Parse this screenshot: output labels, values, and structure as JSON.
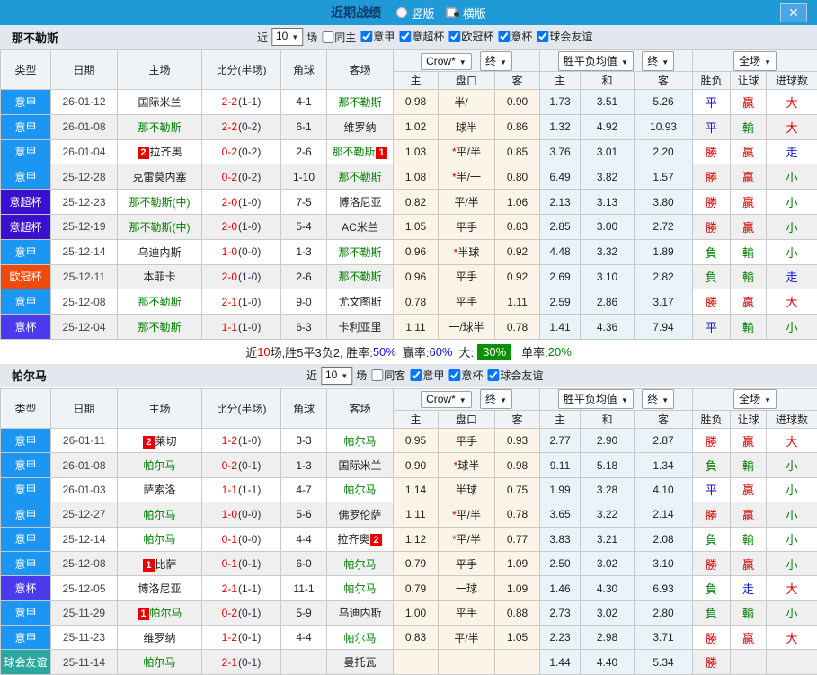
{
  "titlebar": {
    "title": "近期战绩",
    "vertical_label": "竖版",
    "horizontal_label": "横版",
    "selected_layout": "横版",
    "close_icon": "✕"
  },
  "colors": {
    "titlebar_blue": "#1f9ad6",
    "score_red": "#e60000",
    "subject_team_green": "#008000",
    "win_red": "#d40000",
    "lose_green": "#008000",
    "draw_blue": "#1414cc",
    "big_rate_chip_green": "#089000"
  },
  "columns": {
    "type": "类型",
    "date": "日期",
    "home": "主场",
    "score": "比分(半场)",
    "corner": "角球",
    "away": "客场",
    "crow_select": "Crow*",
    "final_select": "终",
    "mean_select": "胜平负均值",
    "final_select2": "终",
    "scope_select": "全场",
    "sub": [
      "主",
      "盘口",
      "客",
      "主",
      "和",
      "客",
      "胜负",
      "让球",
      "进球数"
    ]
  },
  "type_colors": {
    "意甲": "#1b97f3",
    "意超杯": "#3a0fd0",
    "欧冠杯": "#f04a0a",
    "意杯": "#4b3bef",
    "球会友谊": "#2aa8a0"
  },
  "sections": [
    {
      "team": "那不勒斯",
      "filters": {
        "recent_label": "近",
        "count": "10",
        "games_label": "场",
        "same_label": "同主",
        "same_checked": false,
        "leagues": [
          {
            "label": "意甲",
            "checked": true
          },
          {
            "label": "意超杯",
            "checked": true
          },
          {
            "label": "欧冠杯",
            "checked": true
          },
          {
            "label": "意杯",
            "checked": true
          },
          {
            "label": "球会友谊",
            "checked": true
          }
        ]
      },
      "rows": [
        {
          "type": "意甲",
          "date": "26-01-12",
          "home": "国际米兰",
          "home_green": false,
          "home_badge": "",
          "score": "2-2",
          "half": "(1-1)",
          "corner": "4-1",
          "away": "那不勒斯",
          "away_green": true,
          "away_badge": "",
          "crow_home": "0.98",
          "handicap": "半/一",
          "star": false,
          "crow_away": "0.90",
          "mean_home": "1.73",
          "mean_draw": "3.51",
          "mean_away": "5.26",
          "result": "平",
          "result_c": "b",
          "let": "贏",
          "let_c": "r",
          "goal": "大",
          "goal_c": "r"
        },
        {
          "type": "意甲",
          "date": "26-01-08",
          "home": "那不勒斯",
          "home_green": true,
          "home_badge": "",
          "score": "2-2",
          "half": "(0-2)",
          "corner": "6-1",
          "away": "维罗纳",
          "away_green": false,
          "away_badge": "",
          "crow_home": "1.02",
          "handicap": "球半",
          "star": false,
          "crow_away": "0.86",
          "mean_home": "1.32",
          "mean_draw": "4.92",
          "mean_away": "10.93",
          "result": "平",
          "result_c": "b",
          "let": "輸",
          "let_c": "g",
          "goal": "大",
          "goal_c": "r"
        },
        {
          "type": "意甲",
          "date": "26-01-04",
          "home": "拉齐奥",
          "home_green": false,
          "home_badge": "2",
          "score": "0-2",
          "half": "(0-2)",
          "corner": "2-6",
          "away": "那不勒斯",
          "away_green": true,
          "away_badge": "1",
          "crow_home": "1.03",
          "handicap": "平/半",
          "star": true,
          "crow_away": "0.85",
          "mean_home": "3.76",
          "mean_draw": "3.01",
          "mean_away": "2.20",
          "result": "勝",
          "result_c": "r",
          "let": "贏",
          "let_c": "r",
          "goal": "走",
          "goal_c": "b"
        },
        {
          "type": "意甲",
          "date": "25-12-28",
          "home": "克雷莫内塞",
          "home_green": false,
          "home_badge": "",
          "score": "0-2",
          "half": "(0-2)",
          "corner": "1-10",
          "away": "那不勒斯",
          "away_green": true,
          "away_badge": "",
          "crow_home": "1.08",
          "handicap": "半/一",
          "star": true,
          "crow_away": "0.80",
          "mean_home": "6.49",
          "mean_draw": "3.82",
          "mean_away": "1.57",
          "result": "勝",
          "result_c": "r",
          "let": "贏",
          "let_c": "r",
          "goal": "小",
          "goal_c": "g"
        },
        {
          "type": "意超杯",
          "date": "25-12-23",
          "home": "那不勒斯(中)",
          "home_green": true,
          "home_badge": "",
          "score": "2-0",
          "half": "(1-0)",
          "corner": "7-5",
          "away": "博洛尼亚",
          "away_green": false,
          "away_badge": "",
          "crow_home": "0.82",
          "handicap": "平/半",
          "star": false,
          "crow_away": "1.06",
          "mean_home": "2.13",
          "mean_draw": "3.13",
          "mean_away": "3.80",
          "result": "勝",
          "result_c": "r",
          "let": "贏",
          "let_c": "r",
          "goal": "小",
          "goal_c": "g"
        },
        {
          "type": "意超杯",
          "date": "25-12-19",
          "home": "那不勒斯(中)",
          "home_green": true,
          "home_badge": "",
          "score": "2-0",
          "half": "(1-0)",
          "corner": "5-4",
          "away": "AC米兰",
          "away_green": false,
          "away_badge": "",
          "crow_home": "1.05",
          "handicap": "平手",
          "star": false,
          "crow_away": "0.83",
          "mean_home": "2.85",
          "mean_draw": "3.00",
          "mean_away": "2.72",
          "result": "勝",
          "result_c": "r",
          "let": "贏",
          "let_c": "r",
          "goal": "小",
          "goal_c": "g"
        },
        {
          "type": "意甲",
          "date": "25-12-14",
          "home": "乌迪内斯",
          "home_green": false,
          "home_badge": "",
          "score": "1-0",
          "half": "(0-0)",
          "corner": "1-3",
          "away": "那不勒斯",
          "away_green": true,
          "away_badge": "",
          "crow_home": "0.96",
          "handicap": "半球",
          "star": true,
          "crow_away": "0.92",
          "mean_home": "4.48",
          "mean_draw": "3.32",
          "mean_away": "1.89",
          "result": "負",
          "result_c": "g",
          "let": "輸",
          "let_c": "g",
          "goal": "小",
          "goal_c": "g"
        },
        {
          "type": "欧冠杯",
          "date": "25-12-11",
          "home": "本菲卡",
          "home_green": false,
          "home_badge": "",
          "score": "2-0",
          "half": "(1-0)",
          "corner": "2-6",
          "away": "那不勒斯",
          "away_green": true,
          "away_badge": "",
          "crow_home": "0.96",
          "handicap": "平手",
          "star": false,
          "crow_away": "0.92",
          "mean_home": "2.69",
          "mean_draw": "3.10",
          "mean_away": "2.82",
          "result": "負",
          "result_c": "g",
          "let": "輸",
          "let_c": "g",
          "goal": "走",
          "goal_c": "b"
        },
        {
          "type": "意甲",
          "date": "25-12-08",
          "home": "那不勒斯",
          "home_green": true,
          "home_badge": "",
          "score": "2-1",
          "half": "(1-0)",
          "corner": "9-0",
          "away": "尤文图斯",
          "away_green": false,
          "away_badge": "",
          "crow_home": "0.78",
          "handicap": "平手",
          "star": false,
          "crow_away": "1.11",
          "mean_home": "2.59",
          "mean_draw": "2.86",
          "mean_away": "3.17",
          "result": "勝",
          "result_c": "r",
          "let": "贏",
          "let_c": "r",
          "goal": "大",
          "goal_c": "r"
        },
        {
          "type": "意杯",
          "date": "25-12-04",
          "home": "那不勒斯",
          "home_green": true,
          "home_badge": "",
          "score": "1-1",
          "half": "(1-0)",
          "corner": "6-3",
          "away": "卡利亚里",
          "away_green": false,
          "away_badge": "",
          "crow_home": "1.11",
          "handicap": "一/球半",
          "star": false,
          "crow_away": "0.78",
          "mean_home": "1.41",
          "mean_draw": "4.36",
          "mean_away": "7.94",
          "result": "平",
          "result_c": "b",
          "let": "輸",
          "let_c": "g",
          "goal": "小",
          "goal_c": "g"
        }
      ],
      "summary": {
        "prefix": "近",
        "count": "10",
        "text1": "场,胜5平3负2, 胜率:",
        "win_rate": "50%",
        "text2": "赢率:",
        "profit_rate": "60%",
        "text3": "大:",
        "big_rate": "30%",
        "text4": "单率:",
        "odd_rate": "20%"
      }
    },
    {
      "team": "帕尔马",
      "filters": {
        "recent_label": "近",
        "count": "10",
        "games_label": "场",
        "same_label": "同客",
        "same_checked": false,
        "leagues": [
          {
            "label": "意甲",
            "checked": true
          },
          {
            "label": "意杯",
            "checked": true
          },
          {
            "label": "球会友谊",
            "checked": true
          }
        ]
      },
      "rows": [
        {
          "type": "意甲",
          "date": "26-01-11",
          "home": "莱切",
          "home_green": false,
          "home_badge": "2",
          "score": "1-2",
          "half": "(1-0)",
          "corner": "3-3",
          "away": "帕尔马",
          "away_green": true,
          "away_badge": "",
          "crow_home": "0.95",
          "handicap": "平手",
          "star": false,
          "crow_away": "0.93",
          "mean_home": "2.77",
          "mean_draw": "2.90",
          "mean_away": "2.87",
          "result": "勝",
          "result_c": "r",
          "let": "贏",
          "let_c": "r",
          "goal": "大",
          "goal_c": "r"
        },
        {
          "type": "意甲",
          "date": "26-01-08",
          "home": "帕尔马",
          "home_green": true,
          "home_badge": "",
          "score": "0-2",
          "half": "(0-1)",
          "corner": "1-3",
          "away": "国际米兰",
          "away_green": false,
          "away_badge": "",
          "crow_home": "0.90",
          "handicap": "球半",
          "star": true,
          "crow_away": "0.98",
          "mean_home": "9.11",
          "mean_draw": "5.18",
          "mean_away": "1.34",
          "result": "負",
          "result_c": "g",
          "let": "輸",
          "let_c": "g",
          "goal": "小",
          "goal_c": "g"
        },
        {
          "type": "意甲",
          "date": "26-01-03",
          "home": "萨索洛",
          "home_green": false,
          "home_badge": "",
          "score": "1-1",
          "half": "(1-1)",
          "corner": "4-7",
          "away": "帕尔马",
          "away_green": true,
          "away_badge": "",
          "crow_home": "1.14",
          "handicap": "半球",
          "star": false,
          "crow_away": "0.75",
          "mean_home": "1.99",
          "mean_draw": "3.28",
          "mean_away": "4.10",
          "result": "平",
          "result_c": "b",
          "let": "贏",
          "let_c": "r",
          "goal": "小",
          "goal_c": "g"
        },
        {
          "type": "意甲",
          "date": "25-12-27",
          "home": "帕尔马",
          "home_green": true,
          "home_badge": "",
          "score": "1-0",
          "half": "(0-0)",
          "corner": "5-6",
          "away": "佛罗伦萨",
          "away_green": false,
          "away_badge": "",
          "crow_home": "1.11",
          "handicap": "平/半",
          "star": true,
          "crow_away": "0.78",
          "mean_home": "3.65",
          "mean_draw": "3.22",
          "mean_away": "2.14",
          "result": "勝",
          "result_c": "r",
          "let": "贏",
          "let_c": "r",
          "goal": "小",
          "goal_c": "g"
        },
        {
          "type": "意甲",
          "date": "25-12-14",
          "home": "帕尔马",
          "home_green": true,
          "home_badge": "",
          "score": "0-1",
          "half": "(0-0)",
          "corner": "4-4",
          "away": "拉齐奥",
          "away_green": false,
          "away_badge": "2",
          "crow_home": "1.12",
          "handicap": "平/半",
          "star": true,
          "crow_away": "0.77",
          "mean_home": "3.83",
          "mean_draw": "3.21",
          "mean_away": "2.08",
          "result": "負",
          "result_c": "g",
          "let": "輸",
          "let_c": "g",
          "goal": "小",
          "goal_c": "g"
        },
        {
          "type": "意甲",
          "date": "25-12-08",
          "home": "比萨",
          "home_green": false,
          "home_badge": "1",
          "score": "0-1",
          "half": "(0-1)",
          "corner": "6-0",
          "away": "帕尔马",
          "away_green": true,
          "away_badge": "",
          "crow_home": "0.79",
          "handicap": "平手",
          "star": false,
          "crow_away": "1.09",
          "mean_home": "2.50",
          "mean_draw": "3.02",
          "mean_away": "3.10",
          "result": "勝",
          "result_c": "r",
          "let": "贏",
          "let_c": "r",
          "goal": "小",
          "goal_c": "g"
        },
        {
          "type": "意杯",
          "date": "25-12-05",
          "home": "博洛尼亚",
          "home_green": false,
          "home_badge": "",
          "score": "2-1",
          "half": "(1-1)",
          "corner": "11-1",
          "away": "帕尔马",
          "away_green": true,
          "away_badge": "",
          "crow_home": "0.79",
          "handicap": "一球",
          "star": false,
          "crow_away": "1.09",
          "mean_home": "1.46",
          "mean_draw": "4.30",
          "mean_away": "6.93",
          "result": "負",
          "result_c": "g",
          "let": "走",
          "let_c": "b",
          "goal": "大",
          "goal_c": "r"
        },
        {
          "type": "意甲",
          "date": "25-11-29",
          "home": "帕尔马",
          "home_green": true,
          "home_badge": "1",
          "score": "0-2",
          "half": "(0-1)",
          "corner": "5-9",
          "away": "乌迪内斯",
          "away_green": false,
          "away_badge": "",
          "crow_home": "1.00",
          "handicap": "平手",
          "star": false,
          "crow_away": "0.88",
          "mean_home": "2.73",
          "mean_draw": "3.02",
          "mean_away": "2.80",
          "result": "負",
          "result_c": "g",
          "let": "輸",
          "let_c": "g",
          "goal": "小",
          "goal_c": "g"
        },
        {
          "type": "意甲",
          "date": "25-11-23",
          "home": "维罗纳",
          "home_green": false,
          "home_badge": "",
          "score": "1-2",
          "half": "(0-1)",
          "corner": "4-4",
          "away": "帕尔马",
          "away_green": true,
          "away_badge": "",
          "crow_home": "0.83",
          "handicap": "平/半",
          "star": false,
          "crow_away": "1.05",
          "mean_home": "2.23",
          "mean_draw": "2.98",
          "mean_away": "3.71",
          "result": "勝",
          "result_c": "r",
          "let": "贏",
          "let_c": "r",
          "goal": "大",
          "goal_c": "r"
        },
        {
          "type": "球会友谊",
          "date": "25-11-14",
          "home": "帕尔马",
          "home_green": true,
          "home_badge": "",
          "score": "2-1",
          "half": "(0-1)",
          "corner": "",
          "away": "曼托瓦",
          "away_green": false,
          "away_badge": "",
          "crow_home": "",
          "handicap": "",
          "star": false,
          "crow_away": "",
          "mean_home": "1.44",
          "mean_draw": "4.40",
          "mean_away": "5.34",
          "result": "勝",
          "result_c": "r",
          "let": "",
          "let_c": "",
          "goal": "",
          "goal_c": ""
        }
      ],
      "summary": null
    }
  ]
}
